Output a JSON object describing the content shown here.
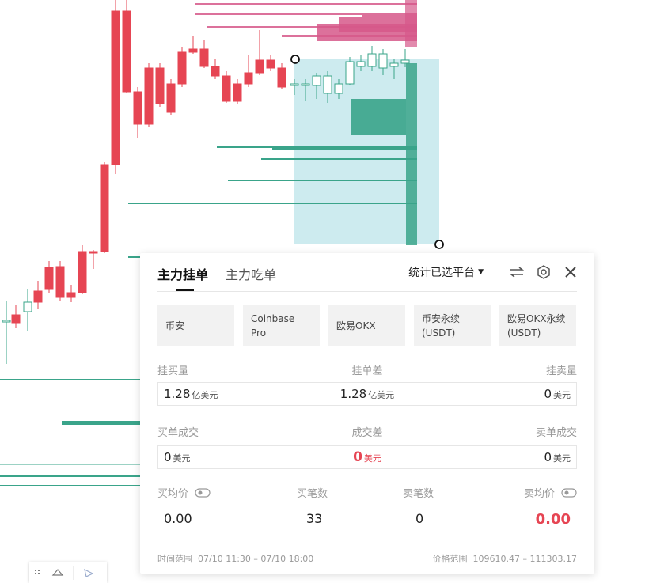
{
  "panel": {
    "tabs": [
      {
        "label": "主力挂单",
        "active": true
      },
      {
        "label": "主力吃单",
        "active": false
      }
    ],
    "platform_select": "统计已选平台",
    "icons": [
      "swap-icon",
      "settings-icon",
      "close-icon"
    ],
    "exchanges": [
      "币安",
      "Coinbase Pro",
      "欧易OKX",
      "币安永续(USDT)",
      "欧易OKX永续(USDT)"
    ],
    "orders": {
      "labels": [
        "挂买量",
        "挂单差",
        "挂卖量"
      ],
      "buy": {
        "value": "1.28",
        "unit": "亿美元"
      },
      "diff": {
        "value": "1.28",
        "unit": "亿美元"
      },
      "sell": {
        "value": "0",
        "unit": "美元"
      }
    },
    "trades": {
      "labels": [
        "买单成交",
        "成交差",
        "卖单成交"
      ],
      "buy": {
        "value": "0",
        "unit": "美元"
      },
      "diff": {
        "value": "0",
        "unit": "美元"
      },
      "sell": {
        "value": "0",
        "unit": "美元"
      }
    },
    "stats": {
      "labels": [
        "买均价",
        "买笔数",
        "卖笔数",
        "卖均价"
      ],
      "values": [
        "0.00",
        "33",
        "0",
        "0.00"
      ]
    },
    "footer": {
      "time_label": "时间范围",
      "time_value": "07/10 11:30 – 07/10 18:00",
      "price_label": "价格范围",
      "price_value": "109610.47 – 111303.17"
    }
  },
  "colors": {
    "up": "#3aa48a",
    "down": "#e64553",
    "sell_wall": "#d6588a",
    "buy_wall": "#3aa48a",
    "selection": "#cdebef"
  }
}
